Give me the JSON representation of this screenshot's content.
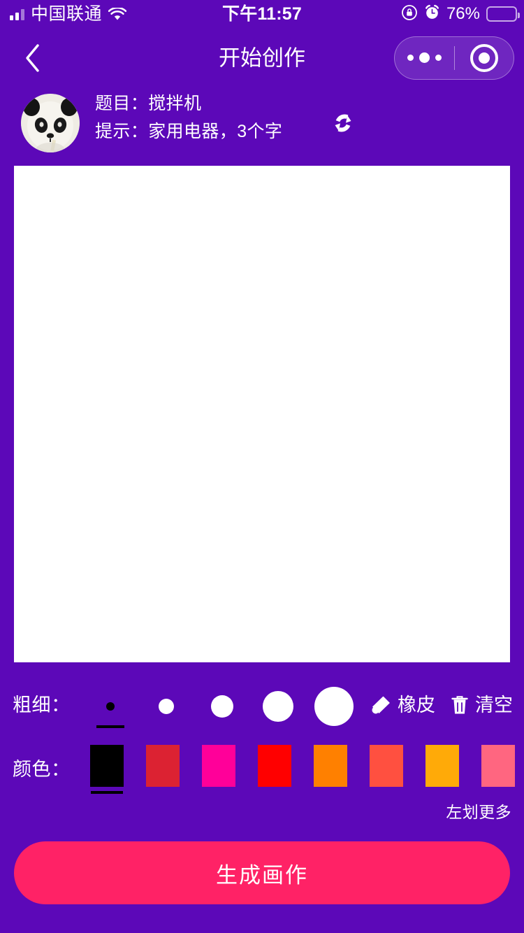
{
  "theme": {
    "background": "#5C08B8",
    "accent": "#FF2266",
    "canvas": "#FFFFFF",
    "battery_fill": "#FFC20A"
  },
  "status_bar": {
    "carrier": "中国联通",
    "signal_icon": "signal-bars-icon",
    "wifi_icon": "wifi-icon",
    "time": "下午11:57",
    "rotation_lock_icon": "rotation-lock-icon",
    "alarm_icon": "alarm-clock-icon",
    "battery_percent": "76%",
    "battery_level": 76,
    "battery_icon": "battery-icon"
  },
  "nav": {
    "back_icon": "chevron-left-icon",
    "title": "开始创作",
    "capsule": {
      "menu_icon": "more-dots-icon",
      "target_icon": "target-circle-icon"
    }
  },
  "task": {
    "avatar_icon": "panda-avatar",
    "subject_line": "题目：搅拌机",
    "hint_line": "提示：家用电器，3个字",
    "subject_label": "题目：",
    "subject_value": "搅拌机",
    "hint_label": "提示：",
    "hint_value": "家用电器，3个字",
    "refresh_icon": "refresh-swap-icon"
  },
  "canvas": {
    "name": "drawing-canvas",
    "content": ""
  },
  "thickness": {
    "label": "粗细：",
    "selected_index": 0,
    "options": [
      {
        "name": "thickness-1",
        "size": 12
      },
      {
        "name": "thickness-2",
        "size": 22
      },
      {
        "name": "thickness-3",
        "size": 32
      },
      {
        "name": "thickness-4",
        "size": 44
      },
      {
        "name": "thickness-5",
        "size": 56
      }
    ],
    "eraser": {
      "label": "橡皮",
      "icon": "eraser-icon"
    },
    "clear": {
      "label": "清空",
      "icon": "trash-icon"
    }
  },
  "colors": {
    "label": "颜色：",
    "selected_index": 0,
    "swatches": [
      {
        "name": "color-black",
        "hex": "#000000"
      },
      {
        "name": "color-crimson",
        "hex": "#DC2232"
      },
      {
        "name": "color-magenta",
        "hex": "#FF0099"
      },
      {
        "name": "color-red",
        "hex": "#FF0000"
      },
      {
        "name": "color-orange",
        "hex": "#FF8000"
      },
      {
        "name": "color-tomato",
        "hex": "#FF5040"
      },
      {
        "name": "color-amber",
        "hex": "#FFAA08"
      },
      {
        "name": "color-salmon",
        "hex": "#FF6680"
      }
    ],
    "more_hint": "左划更多"
  },
  "cta": {
    "label": "生成画作"
  }
}
